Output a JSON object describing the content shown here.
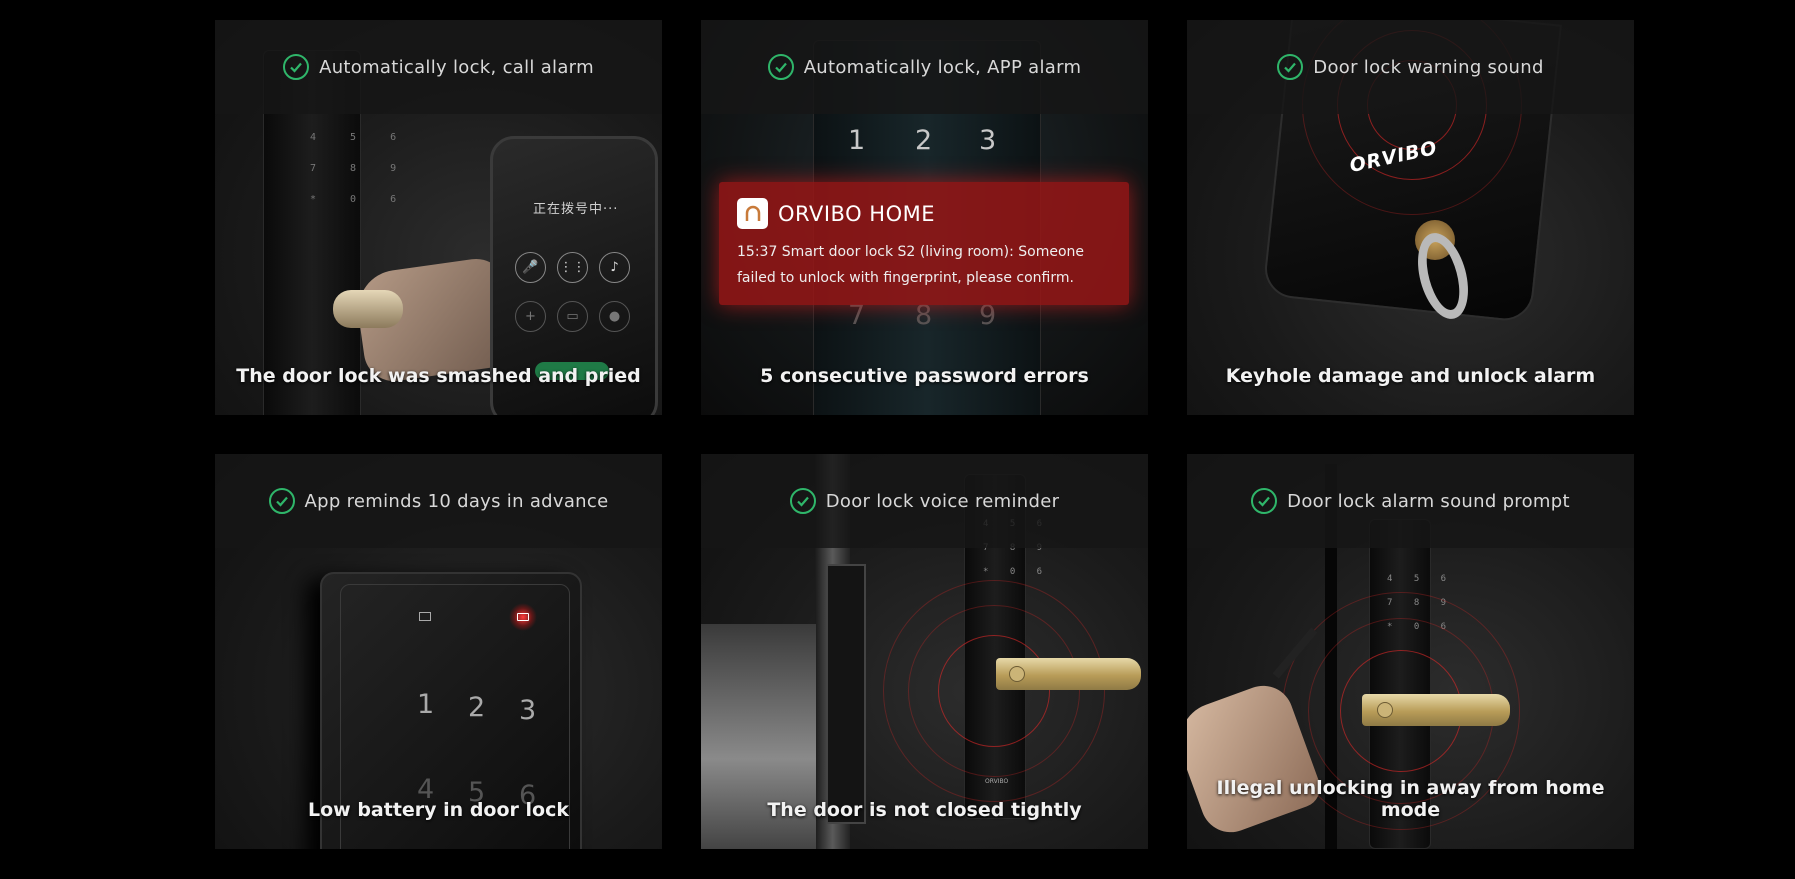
{
  "cards": [
    {
      "feature": "Automatically lock, call alarm",
      "caption": "The door lock was smashed and pried",
      "phone_status": "正在拨号中···"
    },
    {
      "feature": "Automatically lock, APP alarm",
      "caption": "5 consecutive password errors",
      "notification": {
        "app_name": "ORVIBO HOME",
        "message": "15:37 Smart door lock S2 (living room): Someone failed to unlock with fingerprint, please confirm."
      }
    },
    {
      "feature": "Door lock warning sound",
      "caption": "Keyhole damage and unlock alarm",
      "brand": "ORVIBO"
    },
    {
      "feature": "App reminds 10 days in advance",
      "caption": "Low battery in door lock"
    },
    {
      "feature": "Door lock voice reminder",
      "caption": "The door is not closed tightly",
      "brand": "ORVIBO"
    },
    {
      "feature": "Door lock alarm sound prompt",
      "caption": "Illegal unlocking in away from home mode"
    }
  ],
  "colors": {
    "check": "#2fb66a",
    "alert_red": "#961616",
    "handle_gold": "#c9b173"
  }
}
